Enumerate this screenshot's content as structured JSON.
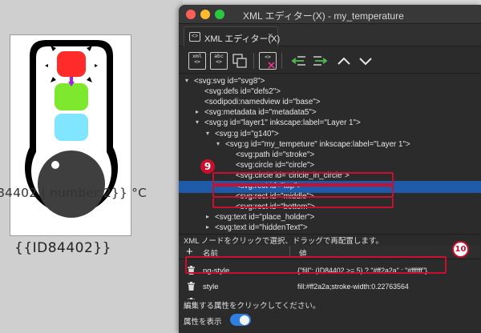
{
  "canvas": {
    "overlay_text": "84402 | number:2}} °C",
    "page_label": "{{ID84402}}"
  },
  "window": {
    "title": "XML エディター(X) - my_temperature",
    "tab_label": "XML エディター(X)",
    "tab_close": "×"
  },
  "toolbar": {
    "new_element": "xml",
    "new_text": "abc",
    "duplicate": "dup",
    "delete": "del",
    "indent": "indent",
    "unindent": "unindent",
    "raise": "up",
    "lower": "down"
  },
  "tree": {
    "nodes": [
      {
        "indent": 1,
        "arrow": "▾",
        "text": "<svg:svg id=\"svg8\">"
      },
      {
        "indent": 2,
        "arrow": "",
        "text": "<svg:defs id=\"defs2\">"
      },
      {
        "indent": 2,
        "arrow": "",
        "text": "<sodipodi:namedview id=\"base\">"
      },
      {
        "indent": 2,
        "arrow": "▸",
        "text": "<svg:metadata id=\"metadata5\">"
      },
      {
        "indent": 2,
        "arrow": "▾",
        "text": "<svg:g id=\"layer1\" inkscape:label=\"Layer 1\">"
      },
      {
        "indent": 3,
        "arrow": "▾",
        "text": "<svg:g id=\"g140\">"
      },
      {
        "indent": 4,
        "arrow": "▾",
        "text": "<svg:g id=\"my_tempeture\" inkscape:label=\"Layer 1\">"
      },
      {
        "indent": 5,
        "arrow": "",
        "text": "<svg:path id=\"stroke\">"
      },
      {
        "indent": 5,
        "arrow": "",
        "text": "<svg:circle id=\"circle\">"
      },
      {
        "indent": 5,
        "arrow": "",
        "text": "<svg:circle id=\"ciricle_in_circle\">"
      },
      {
        "indent": 5,
        "arrow": "",
        "text": "<svg:rect id=\"top\">"
      },
      {
        "indent": 5,
        "arrow": "",
        "text": "<svg:rect id=\"middle\">"
      },
      {
        "indent": 5,
        "arrow": "",
        "text": "<svg:rect id=\"bottom\">"
      },
      {
        "indent": 3,
        "arrow": "▸",
        "text": "<svg:text id=\"place_holder\">"
      },
      {
        "indent": 3,
        "arrow": "▸",
        "text": "<svg:text id=\"hiddenText\">"
      }
    ],
    "selected_index": 10
  },
  "hint": "XML ノードをクリックで選択、ドラッグで再配置します。",
  "attributes": {
    "add": "+",
    "col_name": "名前",
    "col_value": "値",
    "rows": [
      {
        "name": "ng-style",
        "value": "{\"fill\": (ID84402 >= 5) ? \"#ff2a2a\" : \"#ffffff\"}"
      },
      {
        "name": "style",
        "value": "fill:#ff2a2a;stroke-width:0.22763564"
      },
      {
        "name": "id",
        "value": "top"
      }
    ]
  },
  "footer": {
    "edit_hint": "編集する属性をクリックしてください。",
    "show_attrs_label": "属性を表示",
    "show_attrs_on": true
  },
  "annotations": {
    "badge9": "9",
    "badge10": "10"
  },
  "colors": {
    "top_rect": "#ff2a2a",
    "middle_rect": "#7ee82f",
    "bottom_rect": "#80e5ff",
    "selection": "#1e5aa8",
    "annotation": "#c8102e"
  }
}
